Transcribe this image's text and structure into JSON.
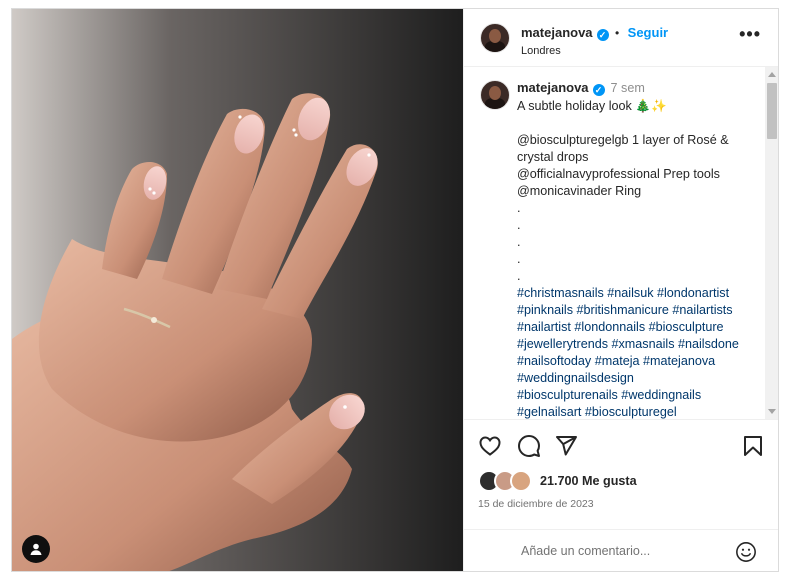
{
  "post": {
    "author": "matejanova",
    "follow_label": "Seguir",
    "location": "Londres",
    "more_label": "•••",
    "caption_time": "7 sem",
    "caption_lines": [
      {
        "text": "A subtle holiday look 🎄✨",
        "tag": false
      },
      {
        "text": "",
        "tag": false
      },
      {
        "text": "@biosculpturegelgb 1 layer of Rosé &",
        "tag": false
      },
      {
        "text": "crystal drops",
        "tag": false
      },
      {
        "text": "@officialnavyprofessional Prep tools",
        "tag": false
      },
      {
        "text": "@monicavinader Ring",
        "tag": false
      },
      {
        "text": ".",
        "tag": false
      },
      {
        "text": ".",
        "tag": false
      },
      {
        "text": ".",
        "tag": false
      },
      {
        "text": ".",
        "tag": false
      },
      {
        "text": ".",
        "tag": false
      },
      {
        "text": "#christmasnails #nailsuk #londonartist",
        "tag": true
      },
      {
        "text": "#pinknails #britishmanicure #nailartists",
        "tag": true
      },
      {
        "text": "#nailartist #londonnails #biosculpture",
        "tag": true
      },
      {
        "text": "#jewellerytrends #xmasnails #nailsdone",
        "tag": true
      },
      {
        "text": "#nailsoftoday #mateja #matejanova",
        "tag": true
      },
      {
        "text": "#weddingnailsdesign",
        "tag": true
      },
      {
        "text": "#biosculpturenails #weddingnails",
        "tag": true
      },
      {
        "text": "#gelnailsart #biosculpturegel",
        "tag": true
      }
    ],
    "likes": "21.700 Me gusta",
    "date": "15 de diciembre de 2023",
    "comment_placeholder": "Añade un comentario...",
    "icons": {
      "like": "heart-icon",
      "comment": "comment-icon",
      "share": "send-icon",
      "save": "bookmark-icon",
      "emoji": "emoji-icon",
      "tagged_users": "user-icon"
    },
    "colors": {
      "link_blue": "#0095f6",
      "hashtag": "#00376b",
      "muted": "#737373"
    }
  }
}
